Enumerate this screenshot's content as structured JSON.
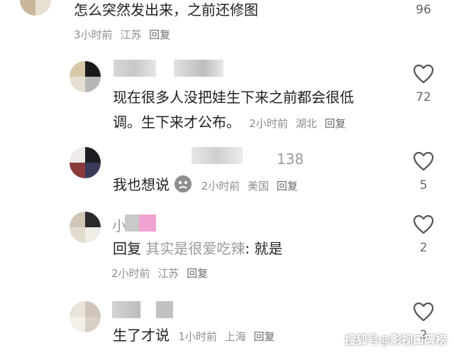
{
  "comments": [
    {
      "text": "怎么突然发出来，之前还修图",
      "time": "3小时前",
      "location": "江苏",
      "reply_label": "回复",
      "likes": "96"
    },
    {
      "text_line1": "现在很多人没把娃生下来之前都会很低",
      "text_line2": "调。生下来才公布。",
      "time": "2小时前",
      "location": "湖北",
      "reply_label": "回复",
      "likes": "72"
    },
    {
      "username_fragment": "138",
      "text": "我也想说",
      "time": "2小时前",
      "location": "美国",
      "reply_label": "回复",
      "likes": "5",
      "emoji": "sad-face-emoji"
    },
    {
      "username_fragment": "小",
      "reply_prefix": "回复",
      "quoted": "其实是很爱吃辣",
      "colon_text": ": 就是",
      "time": "2小时前",
      "location": "江苏",
      "reply_label": "回复",
      "likes": "2"
    },
    {
      "text": "生了才说",
      "time": "1小时前",
      "location": "上海",
      "reply_label": "回复",
      "likes": "2"
    }
  ],
  "watermark": "搜狐号@影视口碑榜",
  "colors": {
    "heart_stroke": "#555555",
    "meta": "#8e8e8e"
  },
  "icons": [
    "heart-icon",
    "sad-face-emoji"
  ]
}
